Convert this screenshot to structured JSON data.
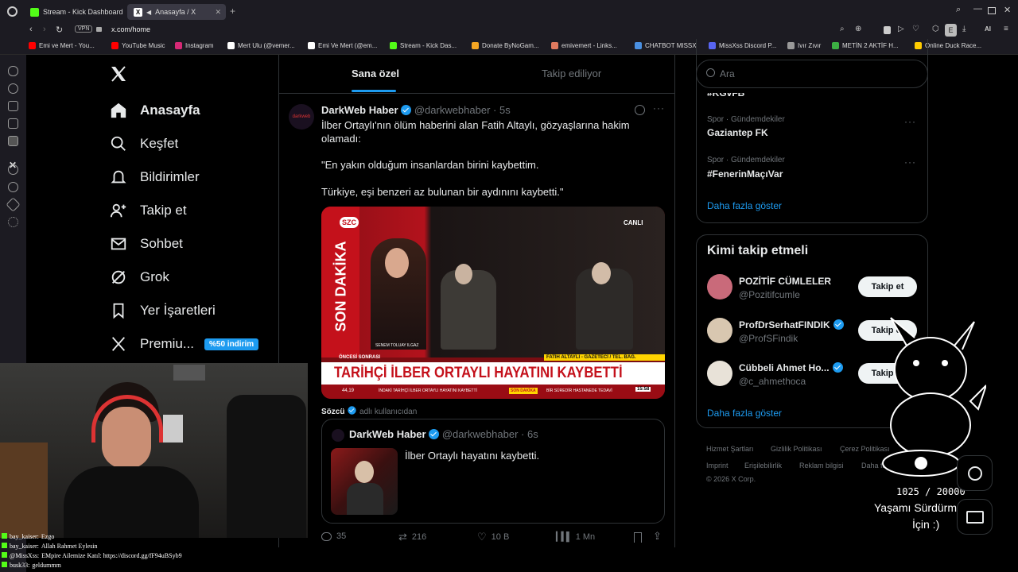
{
  "browser": {
    "tabs": [
      {
        "title": "Stream - Kick Dashboard",
        "active": false,
        "color": "#53fc18"
      },
      {
        "title": "Anasayfa / X",
        "active": true,
        "color": "#ffffff"
      }
    ],
    "url": "x.com/home",
    "vpn_label": "VPN",
    "ai_label": "AI",
    "profile_letter": "E",
    "bookmarks": [
      {
        "label": "Emi ve Mert - You...",
        "color": "#ff0000"
      },
      {
        "label": "YouTube Music",
        "color": "#ff0000"
      },
      {
        "label": "Instagram",
        "color": "#d62976"
      },
      {
        "label": "Mert Ulu (@vemer...",
        "color": "#ffffff"
      },
      {
        "label": "Emi Ve Mert (@em...",
        "color": "#ffffff"
      },
      {
        "label": "Stream - Kick Das...",
        "color": "#53fc18"
      },
      {
        "label": "Donate ByNoGam...",
        "color": "#f5a623"
      },
      {
        "label": "emivemert - Links...",
        "color": "#e07a5f"
      },
      {
        "label": "CHATBOT MISSX",
        "color": "#4a90e2"
      },
      {
        "label": "MissXss Discord P...",
        "color": "#5865f2"
      },
      {
        "label": "Ivır Zıvır",
        "color": "#999999"
      },
      {
        "label": "METİN 2 AKTİF H...",
        "color": "#3cb043"
      },
      {
        "label": "Online Duck Race...",
        "color": "#ffcc00"
      }
    ]
  },
  "x": {
    "nav": [
      {
        "label": "Anasayfa",
        "icon": "home-icon"
      },
      {
        "label": "Keşfet",
        "icon": "search-icon"
      },
      {
        "label": "Bildirimler",
        "icon": "bell-icon"
      },
      {
        "label": "Takip et",
        "icon": "add-person-icon"
      },
      {
        "label": "Sohbet",
        "icon": "mail-icon"
      },
      {
        "label": "Grok",
        "icon": "grok-icon"
      },
      {
        "label": "Yer İşaretleri",
        "icon": "bookmark-icon"
      },
      {
        "label": "Premiu...",
        "icon": "x-logo-icon"
      }
    ],
    "premium_badge": "%50 indirim",
    "feed_tabs": [
      "Sana özel",
      "Takip ediliyor"
    ],
    "tweet": {
      "author": "DarkWeb Haber",
      "handle": "@darkwebhaber",
      "time": "· 5s",
      "avatar_text": "darkweb",
      "text1": "İlber Ortaylı'nın ölüm haberini alan Fatih Altaylı, gözyaşlarına hakim olamadı:",
      "text2": "\"En yakın olduğum insanlardan birini kaybettim.",
      "text3": "Türkiye, eşi benzeri az bulunan bir aydınını kaybetti.\"",
      "media": {
        "channel": "SZC",
        "live": "CANLI",
        "son_dakika": "SON DAKİKA",
        "oncesi": "ÖNCESİ SONRASI",
        "anchor_name": "SENEM TOLUAY ILGAZ",
        "guest_caption": "FATİH ALTAYLI - GAZETECİ / TEL. BAĞ.",
        "headline": "TARİHÇİ İLBER ORTAYLI HAYATINI KAYBETTİ",
        "ticker_value": "44,19",
        "ticker_text": "İNDAKİ TARİHÇİ İLBER ORTAYLI HAYATINI KAYBETTİ",
        "ticker_tag": "SON DAKİKA",
        "ticker_right": "BİR SÜREDİR HASTANEDE TEDAVİ",
        "ticker_time": "15:58"
      },
      "source_name": "Sözcü",
      "source_suffix": "adlı kullanıcıdan",
      "quote": {
        "author": "DarkWeb Haber",
        "handle": "@darkwebhaber",
        "time": "· 6s",
        "text": "İlber Ortaylı hayatını kaybetti."
      },
      "stats": {
        "replies": "35",
        "reposts": "216",
        "likes": "10 B",
        "views": "1 Mn"
      }
    },
    "search_placeholder": "Ara",
    "trends": [
      {
        "category": "",
        "name": "#KGvFB"
      },
      {
        "category": "Spor · Gündemdekiler",
        "name": "Gaziantep FK"
      },
      {
        "category": "Spor · Gündemdekiler",
        "name": "#FenerinMaçıVar"
      }
    ],
    "show_more": "Daha fazla göster",
    "who_to_follow_title": "Kimi takip etmeli",
    "suggestions": [
      {
        "name": "POZİTİF CÜMLELER",
        "handle": "@Pozitifcumle",
        "verified": false,
        "avatar_color": "#c96a7a"
      },
      {
        "name": "ProfDrSerhatFINDIK",
        "handle": "@ProfSFindik",
        "verified": true,
        "avatar_color": "#d8c7b0"
      },
      {
        "name": "Cübbeli Ahmet Ho...",
        "handle": "@c_ahmethoca",
        "verified": true,
        "avatar_color": "#e8e2d8"
      }
    ],
    "follow_label": "Takip et",
    "footer": {
      "row1": [
        "Hizmet Şartları",
        "Gizlilik Politikası",
        "Çerez Politikası"
      ],
      "row2": [
        "Imprint",
        "Erişilebilirlik",
        "Reklam bilgisi",
        "Daha fazla ..."
      ],
      "copyright": "© 2026 X Corp."
    }
  },
  "overlay": {
    "goal_count": "1025 / 20000",
    "goal_text_1": "Yaşamı Sürdürmek",
    "goal_text_2": "İçin :)",
    "chat": [
      {
        "user": "bay_kaiser:",
        "text": "Ezgo"
      },
      {
        "user": "bay_kaiser:",
        "text": "Allah Rahmet Eylesin"
      },
      {
        "user": "@MissXss:",
        "text": "EMpire Ailemize Katıl: https://discord.gg/fF94uBSyb9"
      },
      {
        "user": "busk33:",
        "text": "geldummm"
      }
    ]
  }
}
